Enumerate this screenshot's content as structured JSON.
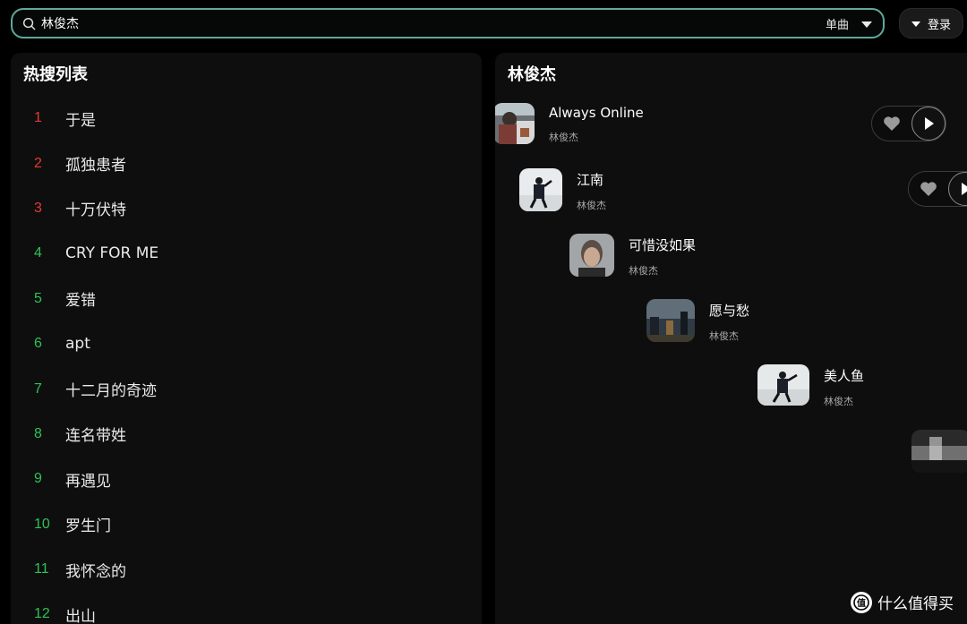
{
  "search": {
    "value": "林俊杰",
    "type_label": "单曲"
  },
  "login": {
    "label": "登录"
  },
  "hot": {
    "title": "热搜列表",
    "items": [
      {
        "rank": "1",
        "name": "于是"
      },
      {
        "rank": "2",
        "name": "孤独患者"
      },
      {
        "rank": "3",
        "name": "十万伏特"
      },
      {
        "rank": "4",
        "name": "CRY FOR ME"
      },
      {
        "rank": "5",
        "name": "爱错"
      },
      {
        "rank": "6",
        "name": "apt"
      },
      {
        "rank": "7",
        "name": "十二月的奇迹"
      },
      {
        "rank": "8",
        "name": "连名带姓"
      },
      {
        "rank": "9",
        "name": "再遇见"
      },
      {
        "rank": "10",
        "name": "罗生门"
      },
      {
        "rank": "11",
        "name": "我怀念的"
      },
      {
        "rank": "12",
        "name": "出山"
      }
    ]
  },
  "results": {
    "title": "林俊杰",
    "songs": [
      {
        "title": "Always Online",
        "artist": "林俊杰"
      },
      {
        "title": "江南",
        "artist": "林俊杰"
      },
      {
        "title": "可惜没如果",
        "artist": "林俊杰"
      },
      {
        "title": "愿与愁",
        "artist": "林俊杰"
      },
      {
        "title": "美人鱼",
        "artist": "林俊杰"
      }
    ]
  },
  "colors": {
    "accent_border": "#5fa89a",
    "rank_top": "#e23b34",
    "rank_normal": "#2fc157"
  },
  "watermark": {
    "text": "什么值得买"
  }
}
